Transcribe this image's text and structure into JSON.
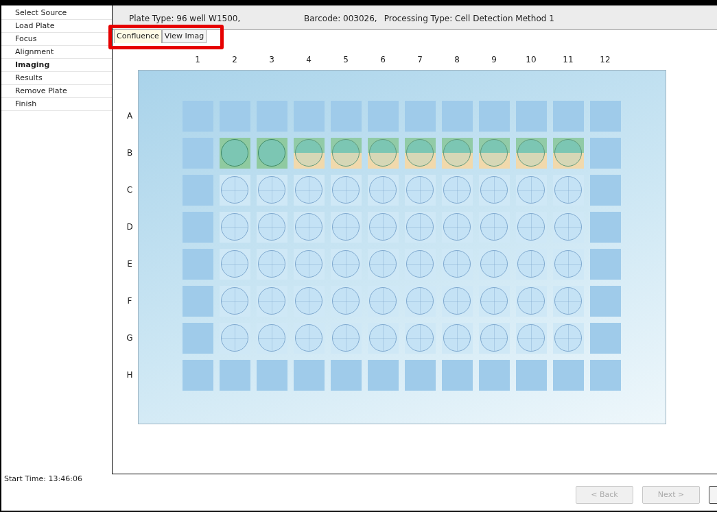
{
  "sidebar": {
    "items": [
      {
        "label": "Select Source",
        "selected": false
      },
      {
        "label": "Load Plate",
        "selected": false
      },
      {
        "label": "Focus",
        "selected": false
      },
      {
        "label": "Alignment",
        "selected": false
      },
      {
        "label": "Imaging",
        "selected": true
      },
      {
        "label": "Results",
        "selected": false
      },
      {
        "label": "Remove Plate",
        "selected": false
      },
      {
        "label": "Finish",
        "selected": false
      }
    ],
    "start_time": "Start Time:  13:46:06"
  },
  "header": {
    "plate_type": "Plate Type: 96 well W1500,",
    "barcode": "Barcode: 003026,",
    "processing_type": "Processing Type: Cell Detection Method 1"
  },
  "tabs": {
    "highlighted": true,
    "items": [
      {
        "label": "Confluence",
        "selected": true
      },
      {
        "label": "View Imag",
        "selected": false
      }
    ]
  },
  "plate": {
    "columns": [
      "1",
      "2",
      "3",
      "4",
      "5",
      "6",
      "7",
      "8",
      "9",
      "10",
      "11",
      "12"
    ],
    "rows": [
      {
        "label": "A",
        "wells": [
          {
            "kind": "blank"
          },
          {
            "kind": "blank"
          },
          {
            "kind": "blank"
          },
          {
            "kind": "blank"
          },
          {
            "kind": "blank"
          },
          {
            "kind": "blank"
          },
          {
            "kind": "blank"
          },
          {
            "kind": "blank"
          },
          {
            "kind": "blank"
          },
          {
            "kind": "blank"
          },
          {
            "kind": "blank"
          },
          {
            "kind": "blank"
          }
        ]
      },
      {
        "label": "B",
        "wells": [
          {
            "kind": "blank"
          },
          {
            "kind": "full"
          },
          {
            "kind": "full"
          },
          {
            "kind": "partial"
          },
          {
            "kind": "partial"
          },
          {
            "kind": "partial"
          },
          {
            "kind": "partial"
          },
          {
            "kind": "partial"
          },
          {
            "kind": "partial"
          },
          {
            "kind": "partial"
          },
          {
            "kind": "partial"
          },
          {
            "kind": "blank"
          }
        ]
      },
      {
        "label": "C",
        "wells": [
          {
            "kind": "blank"
          },
          {
            "kind": "well"
          },
          {
            "kind": "well"
          },
          {
            "kind": "well"
          },
          {
            "kind": "well"
          },
          {
            "kind": "well"
          },
          {
            "kind": "well"
          },
          {
            "kind": "well"
          },
          {
            "kind": "well"
          },
          {
            "kind": "well"
          },
          {
            "kind": "well"
          },
          {
            "kind": "blank"
          }
        ]
      },
      {
        "label": "D",
        "wells": [
          {
            "kind": "blank"
          },
          {
            "kind": "well"
          },
          {
            "kind": "well"
          },
          {
            "kind": "well"
          },
          {
            "kind": "well"
          },
          {
            "kind": "well"
          },
          {
            "kind": "well"
          },
          {
            "kind": "well"
          },
          {
            "kind": "well"
          },
          {
            "kind": "well"
          },
          {
            "kind": "well"
          },
          {
            "kind": "blank"
          }
        ]
      },
      {
        "label": "E",
        "wells": [
          {
            "kind": "blank"
          },
          {
            "kind": "well"
          },
          {
            "kind": "well"
          },
          {
            "kind": "well"
          },
          {
            "kind": "well"
          },
          {
            "kind": "well"
          },
          {
            "kind": "well"
          },
          {
            "kind": "well"
          },
          {
            "kind": "well"
          },
          {
            "kind": "well"
          },
          {
            "kind": "well"
          },
          {
            "kind": "blank"
          }
        ]
      },
      {
        "label": "F",
        "wells": [
          {
            "kind": "blank"
          },
          {
            "kind": "well"
          },
          {
            "kind": "well"
          },
          {
            "kind": "well"
          },
          {
            "kind": "well"
          },
          {
            "kind": "well"
          },
          {
            "kind": "well"
          },
          {
            "kind": "well"
          },
          {
            "kind": "well"
          },
          {
            "kind": "well"
          },
          {
            "kind": "well"
          },
          {
            "kind": "blank"
          }
        ]
      },
      {
        "label": "G",
        "wells": [
          {
            "kind": "blank"
          },
          {
            "kind": "well"
          },
          {
            "kind": "well"
          },
          {
            "kind": "well"
          },
          {
            "kind": "well"
          },
          {
            "kind": "well"
          },
          {
            "kind": "well"
          },
          {
            "kind": "well"
          },
          {
            "kind": "well"
          },
          {
            "kind": "well"
          },
          {
            "kind": "well"
          },
          {
            "kind": "blank"
          }
        ]
      },
      {
        "label": "H",
        "wells": [
          {
            "kind": "blank"
          },
          {
            "kind": "blank"
          },
          {
            "kind": "blank"
          },
          {
            "kind": "blank"
          },
          {
            "kind": "blank"
          },
          {
            "kind": "blank"
          },
          {
            "kind": "blank"
          },
          {
            "kind": "blank"
          },
          {
            "kind": "blank"
          },
          {
            "kind": "blank"
          },
          {
            "kind": "blank"
          },
          {
            "kind": "blank"
          }
        ]
      }
    ]
  },
  "buttons": [
    {
      "label": "< Back",
      "disabled": true
    },
    {
      "label": "Next >",
      "disabled": true
    }
  ]
}
